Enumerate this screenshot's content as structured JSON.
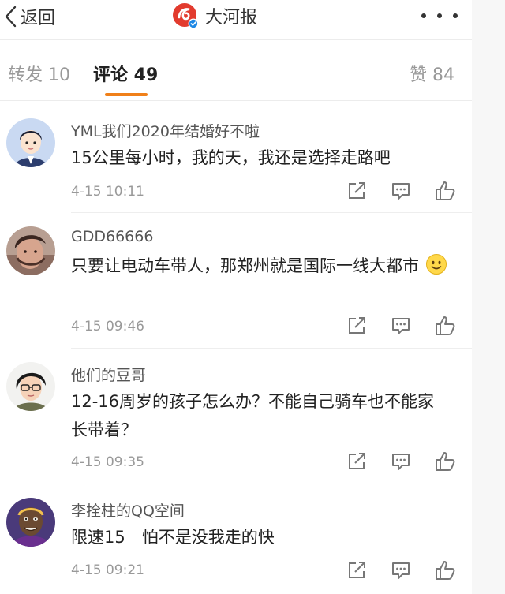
{
  "header": {
    "back_label": "返回",
    "brand_name": "大河报"
  },
  "tabs": {
    "forward": "转发 10",
    "comments": "评论 49",
    "likes": "赞 84"
  },
  "colors": {
    "accent": "#f08019",
    "brand_red": "#e23b2e",
    "verified_blue": "#1e88e5"
  },
  "comments": [
    {
      "username": "YML我们2020年结婚好不啦",
      "text": "15公里每小时，我的天，我还是选择走路吧",
      "time": "4-15 10:11"
    },
    {
      "username": "GDD66666",
      "text": "只要让电动车带人，那郑州就是国际一线大都市",
      "time": "4-15 09:46"
    },
    {
      "username": "他们的豆哥",
      "text": "12-16周岁的孩子怎么办？不能自己骑车也不能家长带着？",
      "time": "4-15 09:35"
    },
    {
      "username": "李拴柱的QQ空间",
      "text": "限速15　怕不是没我走的快",
      "time": "4-15 09:21"
    }
  ]
}
